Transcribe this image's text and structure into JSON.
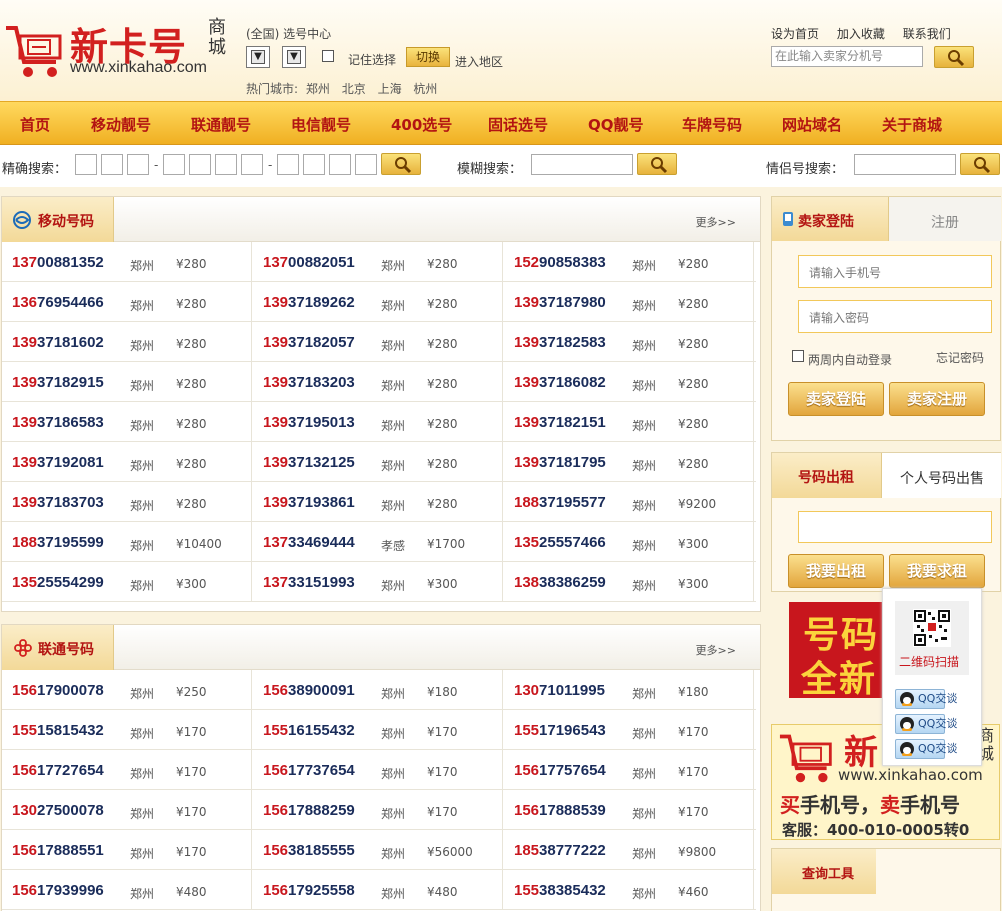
{
  "header": {
    "brand": "新卡号",
    "mall": "商城",
    "url": "www.xinkahao.com",
    "region_label": "(全国) 选号中心",
    "remember_label": "记住选择",
    "switch_button": "切换",
    "enter_region": "进入地区",
    "hot_cities_label": "热门城市:",
    "hot_cities": [
      "郑州",
      "北京",
      "上海",
      "杭州"
    ],
    "top_links": [
      "设为首页",
      "加入收藏",
      "联系我们"
    ],
    "search_placeholder": "在此输入卖家分机号"
  },
  "nav": [
    "首页",
    "移动靓号",
    "联通靓号",
    "电信靓号",
    "400选号",
    "固话选号",
    "QQ靓号",
    "车牌号码",
    "网站域名",
    "关于商城"
  ],
  "search_bar": {
    "exact_label": "精确搜索：",
    "fuzzy_label": "模糊搜索：",
    "couple_label": "情侣号搜索："
  },
  "mobile": {
    "title": "移动号码",
    "more": "更多>>",
    "rows": [
      [
        {
          "pre": "137",
          "rest": "00881352",
          "city": "郑州",
          "price": "¥280"
        },
        {
          "pre": "137",
          "rest": "00882051",
          "city": "郑州",
          "price": "¥280"
        },
        {
          "pre": "152",
          "rest": "90858383",
          "city": "郑州",
          "price": "¥280"
        }
      ],
      [
        {
          "pre": "136",
          "rest": "76954466",
          "city": "郑州",
          "price": "¥280"
        },
        {
          "pre": "139",
          "rest": "37189262",
          "city": "郑州",
          "price": "¥280"
        },
        {
          "pre": "139",
          "rest": "37187980",
          "city": "郑州",
          "price": "¥280"
        }
      ],
      [
        {
          "pre": "139",
          "rest": "37181602",
          "city": "郑州",
          "price": "¥280"
        },
        {
          "pre": "139",
          "rest": "37182057",
          "city": "郑州",
          "price": "¥280"
        },
        {
          "pre": "139",
          "rest": "37182583",
          "city": "郑州",
          "price": "¥280"
        }
      ],
      [
        {
          "pre": "139",
          "rest": "37182915",
          "city": "郑州",
          "price": "¥280"
        },
        {
          "pre": "139",
          "rest": "37183203",
          "city": "郑州",
          "price": "¥280"
        },
        {
          "pre": "139",
          "rest": "37186082",
          "city": "郑州",
          "price": "¥280"
        }
      ],
      [
        {
          "pre": "139",
          "rest": "37186583",
          "city": "郑州",
          "price": "¥280"
        },
        {
          "pre": "139",
          "rest": "37195013",
          "city": "郑州",
          "price": "¥280"
        },
        {
          "pre": "139",
          "rest": "37182151",
          "city": "郑州",
          "price": "¥280"
        }
      ],
      [
        {
          "pre": "139",
          "rest": "37192081",
          "city": "郑州",
          "price": "¥280"
        },
        {
          "pre": "139",
          "rest": "37132125",
          "city": "郑州",
          "price": "¥280"
        },
        {
          "pre": "139",
          "rest": "37181795",
          "city": "郑州",
          "price": "¥280"
        }
      ],
      [
        {
          "pre": "139",
          "rest": "37183703",
          "city": "郑州",
          "price": "¥280"
        },
        {
          "pre": "139",
          "rest": "37193861",
          "city": "郑州",
          "price": "¥280"
        },
        {
          "pre": "188",
          "rest": "37195577",
          "city": "郑州",
          "price": "¥9200"
        }
      ],
      [
        {
          "pre": "188",
          "rest": "37195599",
          "city": "郑州",
          "price": "¥10400"
        },
        {
          "pre": "137",
          "rest": "33469444",
          "city": "孝感",
          "price": "¥1700"
        },
        {
          "pre": "135",
          "rest": "25557466",
          "city": "郑州",
          "price": "¥300"
        }
      ],
      [
        {
          "pre": "135",
          "rest": "25554299",
          "city": "郑州",
          "price": "¥300"
        },
        {
          "pre": "137",
          "rest": "33151993",
          "city": "郑州",
          "price": "¥300"
        },
        {
          "pre": "138",
          "rest": "38386259",
          "city": "郑州",
          "price": "¥300"
        }
      ]
    ]
  },
  "unicom": {
    "title": "联通号码",
    "more": "更多>>",
    "rows": [
      [
        {
          "pre": "156",
          "rest": "17900078",
          "city": "郑州",
          "price": "¥250"
        },
        {
          "pre": "156",
          "rest": "38900091",
          "city": "郑州",
          "price": "¥180"
        },
        {
          "pre": "130",
          "rest": "71011995",
          "city": "郑州",
          "price": "¥180"
        }
      ],
      [
        {
          "pre": "155",
          "rest": "15815432",
          "city": "郑州",
          "price": "¥170"
        },
        {
          "pre": "155",
          "rest": "16155432",
          "city": "郑州",
          "price": "¥170"
        },
        {
          "pre": "155",
          "rest": "17196543",
          "city": "郑州",
          "price": "¥170"
        }
      ],
      [
        {
          "pre": "156",
          "rest": "17727654",
          "city": "郑州",
          "price": "¥170"
        },
        {
          "pre": "156",
          "rest": "17737654",
          "city": "郑州",
          "price": "¥170"
        },
        {
          "pre": "156",
          "rest": "17757654",
          "city": "郑州",
          "price": "¥170"
        }
      ],
      [
        {
          "pre": "130",
          "rest": "27500078",
          "city": "郑州",
          "price": "¥170"
        },
        {
          "pre": "156",
          "rest": "17888259",
          "city": "郑州",
          "price": "¥170"
        },
        {
          "pre": "156",
          "rest": "17888539",
          "city": "郑州",
          "price": "¥170"
        }
      ],
      [
        {
          "pre": "156",
          "rest": "17888551",
          "city": "郑州",
          "price": "¥170"
        },
        {
          "pre": "156",
          "rest": "38185555",
          "city": "郑州",
          "price": "¥56000"
        },
        {
          "pre": "185",
          "rest": "38777222",
          "city": "郑州",
          "price": "¥9800"
        }
      ],
      [
        {
          "pre": "156",
          "rest": "17939996",
          "city": "郑州",
          "price": "¥480"
        },
        {
          "pre": "156",
          "rest": "17925558",
          "city": "郑州",
          "price": "¥480"
        },
        {
          "pre": "155",
          "rest": "38385432",
          "city": "郑州",
          "price": "¥460"
        }
      ]
    ]
  },
  "login": {
    "tab_login": "卖家登陆",
    "tab_register": "注册",
    "phone_placeholder": "请输入手机号",
    "password_placeholder": "请输入密码",
    "auto_login": "两周内自动登录",
    "forgot": "忘记密码",
    "login_button": "卖家登陆",
    "register_button": "卖家注册"
  },
  "rent": {
    "tab_rent": "号码出租",
    "tab_personal": "个人号码出售",
    "rent_button": "我要出租",
    "want_button": "我要求租"
  },
  "banner1": {
    "line1": "号码",
    "line2": "全新"
  },
  "float": {
    "qr_label": "二维码扫描",
    "qq_label": "QQ交谈"
  },
  "banner2": {
    "brand": "新",
    "mall": "商城",
    "url": "www.xinkahao.com",
    "slogan_a": "买",
    "slogan_b": "手机号，",
    "slogan_c": "卖",
    "slogan_d": "手机号",
    "service": "客服：400-010-0005转0"
  },
  "tools": {
    "title": "查询工具"
  }
}
